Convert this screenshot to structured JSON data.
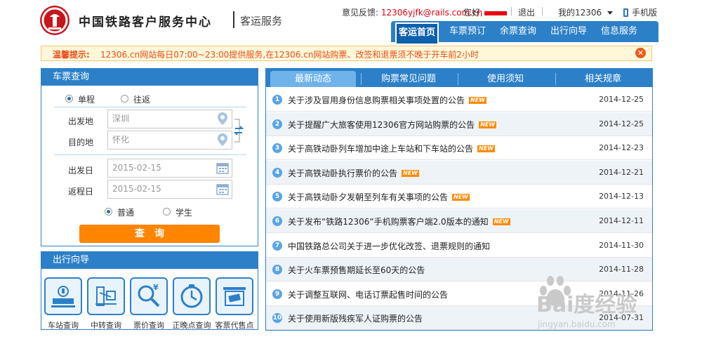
{
  "header": {
    "brand": "中国铁路客户服务中心",
    "sub": "客运服务",
    "feedback_label": "意见反馈:",
    "feedback_email": "12306yjfk@rails.com.cn",
    "greeting": "您好,",
    "logout": "退出",
    "my12306": "我的12306",
    "mobile": "手机版"
  },
  "nav": [
    {
      "label": "客运首页",
      "active": true
    },
    {
      "label": "车票预订"
    },
    {
      "label": "余票查询"
    },
    {
      "label": "出行向导"
    },
    {
      "label": "信息服务"
    }
  ],
  "notice": {
    "label": "温馨提示:",
    "text": "12306.cn网站每日07:00~23:00提供服务,在12306.cn网站购票、改签和退票须不晚于开车前2小时"
  },
  "booking": {
    "title": "车票查询",
    "trip_single": "单程",
    "trip_round": "往返",
    "from_label": "出发地",
    "from_value": "深圳",
    "to_label": "目的地",
    "to_value": "怀化",
    "depart_label": "出发日",
    "depart_value": "2015-02-15",
    "return_label": "返程日",
    "return_value": "2015-02-15",
    "type_normal": "普通",
    "type_student": "学生",
    "search": "查询"
  },
  "guide": {
    "title": "出行向导",
    "items": [
      {
        "label": "车站查询",
        "icon": "station-icon"
      },
      {
        "label": "中转查询",
        "icon": "transfer-icon"
      },
      {
        "label": "票价查询",
        "icon": "price-search-icon"
      },
      {
        "label": "正晚点查询",
        "icon": "clock-icon"
      },
      {
        "label": "客票代售点",
        "icon": "ticket-agency-icon"
      }
    ]
  },
  "news": {
    "tabs": [
      "最新动态",
      "购票常见问题",
      "使用须知",
      "相关规章"
    ],
    "new_tag": "NEW",
    "items": [
      {
        "num": "1",
        "title": "关于涉及冒用身份信息购票相关事项处置的公告",
        "date": "2014-12-25",
        "new": true
      },
      {
        "num": "2",
        "title": "关于提醒广大旅客使用12306官方网站购票的公告",
        "date": "2014-12-25",
        "new": true
      },
      {
        "num": "3",
        "title": "关于高铁动卧列车增加中途上车站和下车站的公告",
        "date": "2014-12-23",
        "new": true
      },
      {
        "num": "4",
        "title": "关于高铁动卧执行票价的公告",
        "date": "2014-12-21",
        "new": true
      },
      {
        "num": "5",
        "title": "关于高铁动卧夕发朝至列车有关事项的公告",
        "date": "2014-12-13",
        "new": true
      },
      {
        "num": "6",
        "title": "关于发布“铁路12306”手机购票客户端2.0版本的通知",
        "date": "2014-12-11",
        "new": true
      },
      {
        "num": "7",
        "title": "中国铁路总公司关于进一步优化改签、退票规则的通知",
        "date": "2014-11-30",
        "new": false
      },
      {
        "num": "8",
        "title": "关于火车票预售期延长至60天的公告",
        "date": "2014-11-28",
        "new": false
      },
      {
        "num": "9",
        "title": "关于调整互联网、电话订票起售时间的公告",
        "date": "2014-11-26",
        "new": false
      },
      {
        "num": "10",
        "title": "关于使用新版残疾军人证购票的公告",
        "date": "2014-07-31",
        "new": false
      }
    ]
  },
  "watermark": {
    "text": "Bai度经验",
    "sub": "jingyan.baidu.com"
  },
  "colors": {
    "primary": "#2c80c8",
    "accent": "#ff8400",
    "notice": "#e94e1b",
    "brand_red": "#c8161d"
  }
}
